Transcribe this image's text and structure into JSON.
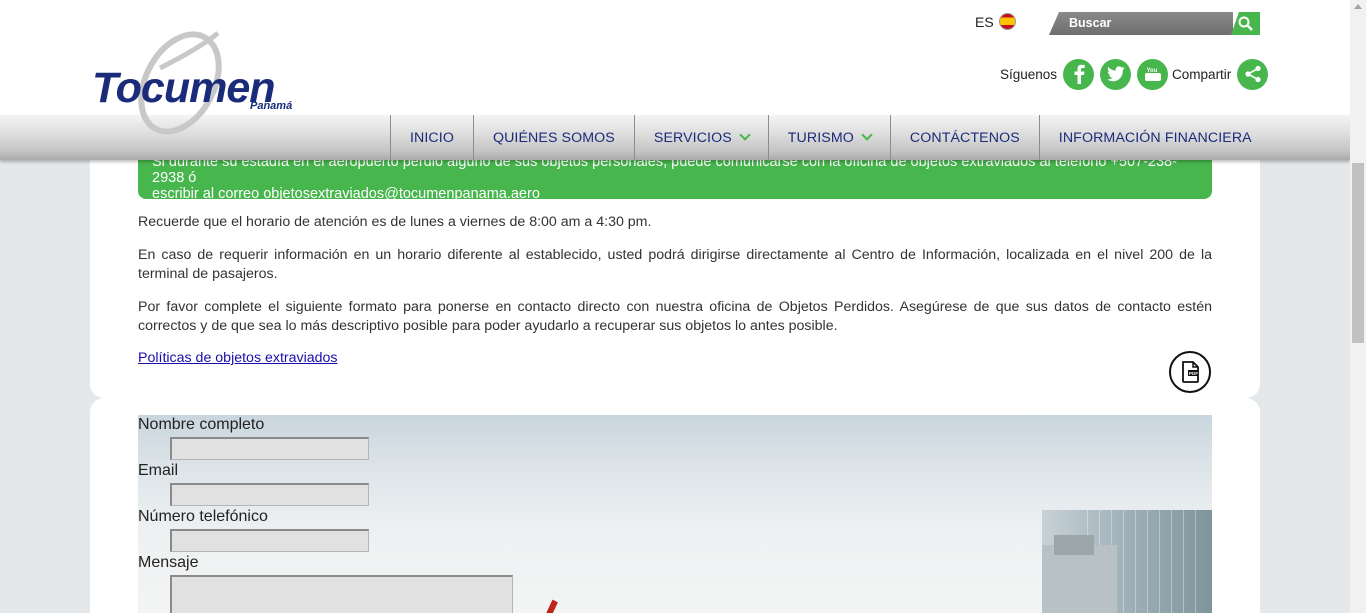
{
  "header": {
    "logo_text": "Tocumen",
    "logo_sub": "Panamá",
    "lang_label": "ES",
    "search_placeholder": "Buscar",
    "follow_label": "Síguenos",
    "share_label": "Compartir",
    "social_icons": [
      "facebook-icon",
      "twitter-icon",
      "youtube-icon"
    ]
  },
  "nav": {
    "items": [
      {
        "label": "INICIO",
        "dropdown": false
      },
      {
        "label": "QUIÉNES SOMOS",
        "dropdown": false
      },
      {
        "label": "SERVICIOS",
        "dropdown": true
      },
      {
        "label": "TURISMO",
        "dropdown": true
      },
      {
        "label": "CONTÁCTENOS",
        "dropdown": false
      },
      {
        "label": "INFORMACIÓN FINANCIERA",
        "dropdown": false
      }
    ]
  },
  "content": {
    "notice_line1": "Si durante su estadía en el aeropuerto perdió alguno de sus objetos personales, puede comunicarse con la oficina de objetos extraviados al teléfono +507-238-2938 ó",
    "notice_line2": "escribir al correo objetosextraviados@tocumenpanama.aero",
    "p1": "Recuerde que el horario de atención es de lunes a viernes de 8:00 am a 4:30 pm.",
    "p2": "En caso de requerir información en un horario diferente al establecido, usted podrá dirigirse directamente al Centro de Información, localizada en el nivel 200 de la terminal de pasajeros.",
    "p3": "Por favor complete el siguiente formato para ponerse en contacto directo con nuestra oficina de Objetos Perdidos. Asegúrese de que sus datos de contacto estén correctos y de que sea lo más descriptivo posible para poder ayudarlo a recuperar sus objetos lo antes posible.",
    "policy_link": "Políticas de objetos extraviados",
    "pdf_icon": "pdf-icon"
  },
  "form": {
    "name_label": "Nombre completo",
    "name_value": "",
    "email_label": "Email",
    "email_value": "",
    "phone_label": "Número telefónico",
    "phone_value": "",
    "message_label": "Mensaje",
    "message_value": ""
  },
  "colors": {
    "brand_blue": "#1a2b7a",
    "brand_green": "#47b64d"
  }
}
